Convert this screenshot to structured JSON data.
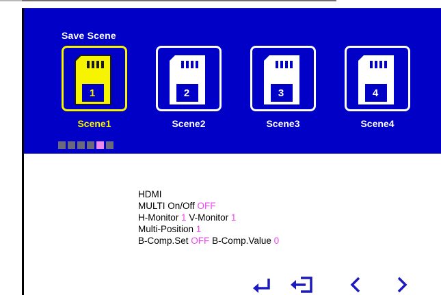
{
  "header": {
    "title": "Save Scene"
  },
  "scenes": [
    {
      "number": "1",
      "label": "Scene1",
      "selected": true
    },
    {
      "number": "2",
      "label": "Scene2",
      "selected": false
    },
    {
      "number": "3",
      "label": "Scene3",
      "selected": false
    },
    {
      "number": "4",
      "label": "Scene4",
      "selected": false
    }
  ],
  "page_indicator": {
    "count": 6,
    "active_index": 4
  },
  "info": {
    "source": "HDMI",
    "multi_label": "MULTI On/Off",
    "multi_value": "OFF",
    "h_monitor_label": "H-Monitor",
    "h_monitor_value": "1",
    "v_monitor_label": "V-Monitor",
    "v_monitor_value": "1",
    "multi_position_label": "Multi-Position",
    "multi_position_value": "1",
    "bcomp_set_label": "B-Comp.Set",
    "bcomp_set_value": "OFF",
    "bcomp_value_label": "B-Comp.Value",
    "bcomp_value_value": "0"
  },
  "nav": [
    "enter-icon",
    "exit-icon",
    "chevron-left-icon",
    "chevron-right-icon"
  ],
  "colors": {
    "header_bg": "#0000c6",
    "selected": "#f7f400",
    "value_text": "#ee44ee",
    "nav_icon": "#1a1ac0",
    "dot_inactive": "#6a6a7a",
    "dot_active": "#f088f0"
  }
}
